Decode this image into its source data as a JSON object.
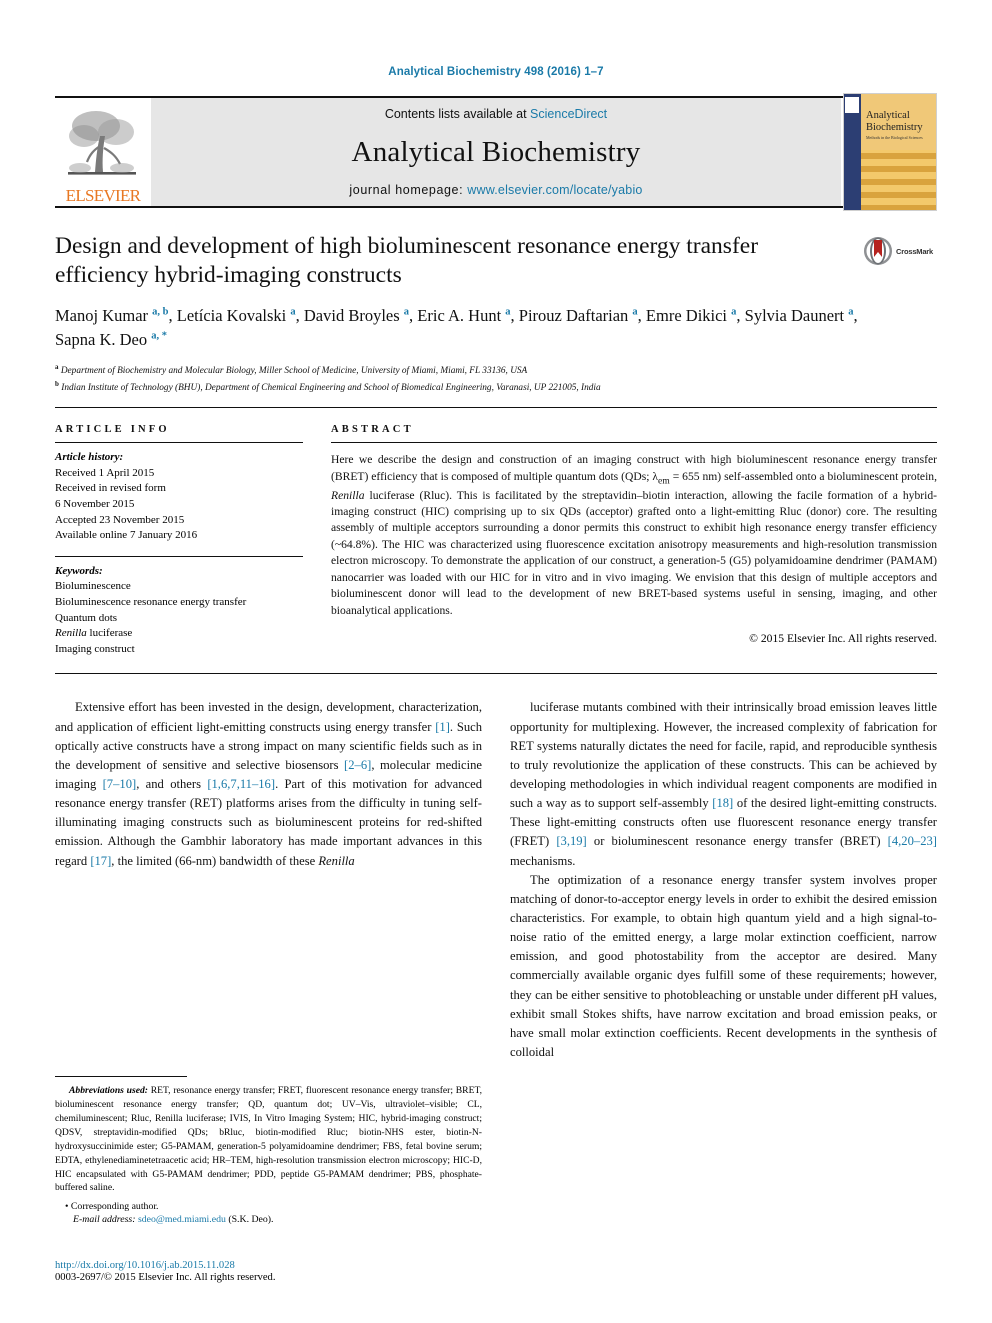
{
  "running_head": "Analytical Biochemistry 498 (2016) 1–7",
  "masthead": {
    "publisher_name": "ELSEVIER",
    "contents_prefix": "Contents lists available at ",
    "contents_link": "ScienceDirect",
    "journal_title": "Analytical Biochemistry",
    "homepage_prefix": "journal homepage: ",
    "homepage_url": "www.elsevier.com/locate/yabio",
    "cover": {
      "line1": "Analytical",
      "line2": "Biochemistry",
      "subtitle": "Methods in the Biological Sciences"
    }
  },
  "article": {
    "title": "Design and development of high bioluminescent resonance energy transfer efficiency hybrid-imaging constructs",
    "crossmark_label": "CrossMark",
    "authors_html": "Manoj Kumar <sup>a, b</sup>, Letícia Kovalski <sup>a</sup>, David Broyles <sup>a</sup>, Eric A. Hunt <sup>a</sup>, Pirouz Daftarian <sup>a</sup>, Emre Dikici <sup>a</sup>, Sylvia Daunert <sup>a</sup>, Sapna K. Deo <sup>a, *</sup>",
    "affiliations": [
      {
        "marker": "a",
        "text": "Department of Biochemistry and Molecular Biology, Miller School of Medicine, University of Miami, Miami, FL 33136, USA"
      },
      {
        "marker": "b",
        "text": "Indian Institute of Technology (BHU), Department of Chemical Engineering and School of Biomedical Engineering, Varanasi, UP 221005, India"
      }
    ]
  },
  "article_info": {
    "heading": "ARTICLE INFO",
    "history_label": "Article history:",
    "history": [
      "Received 1 April 2015",
      "Received in revised form",
      "6 November 2015",
      "Accepted 23 November 2015",
      "Available online 7 January 2016"
    ],
    "keywords_label": "Keywords:",
    "keywords": [
      "Bioluminescence",
      "Bioluminescence resonance energy transfer",
      "Quantum dots",
      "Renilla luciferase",
      "Imaging construct"
    ],
    "keyword_italic_index": 3,
    "keyword_italic_word": "Renilla"
  },
  "abstract": {
    "heading": "ABSTRACT",
    "text_html": "Here we describe the design and construction of an imaging construct with high bioluminescent resonance energy transfer (BRET) efficiency that is composed of multiple quantum dots (QDs; λ<sub>em</sub> = 655 nm) self-assembled onto a bioluminescent protein, <i>Renilla</i> luciferase (Rluc). This is facilitated by the streptavidin–biotin interaction, allowing the facile formation of a hybrid-imaging construct (HIC) comprising up to six QDs (acceptor) grafted onto a light-emitting Rluc (donor) core. The resulting assembly of multiple acceptors surrounding a donor permits this construct to exhibit high resonance energy transfer efficiency (~64.8%). The HIC was characterized using fluorescence excitation anisotropy measurements and high-resolution transmission electron microscopy. To demonstrate the application of our construct, a generation-5 (G5) polyamidoamine dendrimer (PAMAM) nanocarrier was loaded with our HIC for in vitro and in vivo imaging. We envision that this design of multiple acceptors and bioluminescent donor will lead to the development of new BRET-based systems useful in sensing, imaging, and other bioanalytical applications.",
    "copyright": "© 2015 Elsevier Inc. All rights reserved."
  },
  "body": {
    "left_paragraphs_html": [
      "Extensive effort has been invested in the design, development, characterization, and application of efficient light-emitting constructs using energy transfer <span class=\"ref\">[1]</span>. Such optically active constructs have a strong impact on many scientific fields such as in the development of sensitive and selective biosensors <span class=\"ref\">[2–6]</span>, molecular medicine imaging <span class=\"ref\">[7–10]</span>, and others <span class=\"ref\">[1,6,7,11–16]</span>. Part of this motivation for advanced resonance energy transfer (RET) platforms arises from the difficulty in tuning self-illuminating imaging constructs such as bioluminescent proteins for red-shifted emission. Although the Gambhir laboratory has made important advances in this regard <span class=\"ref\">[17]</span>, the limited (66-nm) bandwidth of these <i>Renilla</i>"
    ],
    "right_paragraphs_html": [
      "luciferase mutants combined with their intrinsically broad emission leaves little opportunity for multiplexing. However, the increased complexity of fabrication for RET systems naturally dictates the need for facile, rapid, and reproducible synthesis to truly revolutionize the application of these constructs. This can be achieved by developing methodologies in which individual reagent components are modified in such a way as to support self-assembly <span class=\"ref\">[18]</span> of the desired light-emitting constructs. These light-emitting constructs often use fluorescent resonance energy transfer (FRET) <span class=\"ref\">[3,19]</span> or bioluminescent resonance energy transfer (BRET) <span class=\"ref\">[4,20–23]</span> mechanisms.",
      "The optimization of a resonance energy transfer system involves proper matching of donor-to-acceptor energy levels in order to exhibit the desired emission characteristics. For example, to obtain high quantum yield and a high signal-to-noise ratio of the emitted energy, a large molar extinction coefficient, narrow emission, and good photostability from the acceptor are desired. Many commercially available organic dyes fulfill some of these requirements; however, they can be either sensitive to photobleaching or unstable under different pH values, exhibit small Stokes shifts, have narrow excitation and broad emission peaks, or have small molar extinction coefficients. Recent developments in the synthesis of colloidal"
    ]
  },
  "footnotes": {
    "abbreviations_html": "<i>Abbreviations used:</i> RET, resonance energy transfer; FRET, fluorescent resonance energy transfer; BRET, bioluminescent resonance energy transfer; QD, quantum dot; UV–Vis, ultraviolet–visible; CL, chemiluminescent; Rluc, Renilla luciferase; IVIS, In Vitro Imaging System; HIC, hybrid-imaging construct; QDSV, streptavidin-modified QDs; bRluc, biotin-modified Rluc; biotin-NHS ester, biotin-N-hydroxysuccinimide ester; G5-PAMAM, generation-5 polyamidoamine dendrimer; FBS, fetal bovine serum; EDTA, ethylenediaminetetraacetic acid; HR–TEM, high-resolution transmission electron microscopy; HIC-D, HIC encapsulated with G5-PAMAM dendrimer; PDD, peptide G5-PAMAM dendrimer; PBS, phosphate-buffered saline.",
    "corresponding": "Corresponding author.",
    "email_label": "E-mail address:",
    "email": "sdeo@med.miami.edu",
    "email_suffix": "(S.K. Deo)."
  },
  "footer": {
    "doi": "http://dx.doi.org/10.1016/j.ab.2015.11.028",
    "issn_line": "0003-2697/© 2015 Elsevier Inc. All rights reserved."
  },
  "colors": {
    "link": "#1a7aa8",
    "elsevier_orange": "#e87722",
    "masthead_gray": "#e6e6e6"
  }
}
